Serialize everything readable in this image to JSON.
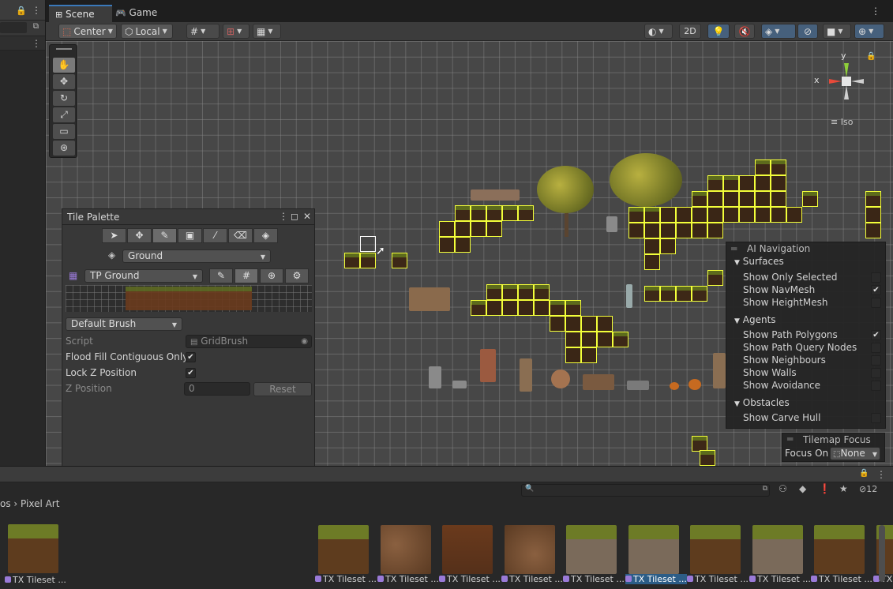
{
  "window": {
    "tabs": [
      {
        "label": "Scene",
        "active": true,
        "icon": "grid-icon"
      },
      {
        "label": "Game",
        "active": false,
        "icon": "gamepad-icon"
      }
    ]
  },
  "toolbar": {
    "pivot": "Center",
    "space": "Local",
    "mode_2d": "2D"
  },
  "gizmo": {
    "y": "y",
    "x": "x",
    "projection": "Iso"
  },
  "tile_palette": {
    "title": "Tile Palette",
    "layer_dropdown": "Ground",
    "palette_dropdown": "TP Ground",
    "brush_dropdown": "Default Brush",
    "script_label": "Script",
    "script_value": "GridBrush",
    "flood_fill_label": "Flood Fill Contiguous Only",
    "flood_fill_checked": true,
    "lock_z_label": "Lock Z Position",
    "lock_z_checked": true,
    "z_position_label": "Z Position",
    "z_position_value": "0",
    "reset_label": "Reset"
  },
  "ai_navigation": {
    "title": "AI Navigation",
    "surfaces_label": "Surfaces",
    "surfaces": [
      {
        "label": "Show Only Selected",
        "checked": false
      },
      {
        "label": "Show NavMesh",
        "checked": true
      },
      {
        "label": "Show HeightMesh",
        "checked": false
      }
    ],
    "agents_label": "Agents",
    "agents": [
      {
        "label": "Show Path Polygons",
        "checked": true
      },
      {
        "label": "Show Path Query Nodes",
        "checked": false
      },
      {
        "label": "Show Neighbours",
        "checked": false
      },
      {
        "label": "Show Walls",
        "checked": false
      },
      {
        "label": "Show Avoidance",
        "checked": false
      }
    ],
    "obstacles_label": "Obstacles",
    "obstacles": [
      {
        "label": "Show Carve Hull",
        "checked": false
      }
    ]
  },
  "tilemap_focus": {
    "title": "Tilemap Focus",
    "focus_on_label": "Focus On",
    "focus_on_value": "None"
  },
  "project": {
    "breadcrumb_prefix": "os",
    "breadcrumb_folder": "Pixel Art",
    "hidden_count": "12",
    "assets": [
      {
        "label": "TX Tileset ...",
        "kind": "grass"
      },
      {
        "label": "TX Tileset ...",
        "kind": "rock"
      },
      {
        "label": "TX Tileset ...",
        "kind": "dirt"
      },
      {
        "label": "TX Tileset ...",
        "kind": "rock2"
      },
      {
        "label": "TX Tileset ...",
        "kind": "grass-rock"
      },
      {
        "label": "TX Tileset ...",
        "kind": "grass-rock",
        "selected": true
      },
      {
        "label": "TX Tileset ...",
        "kind": "grass"
      },
      {
        "label": "TX Tileset ...",
        "kind": "grass-rock"
      },
      {
        "label": "TX Tileset ...",
        "kind": "grass"
      },
      {
        "label": "TX Tileset ...",
        "kind": "grass"
      }
    ],
    "first_asset_label": "TX Tileset ..."
  },
  "colors": {
    "tile_outline": "#f3ff3a",
    "accent": "#3a79bb"
  }
}
